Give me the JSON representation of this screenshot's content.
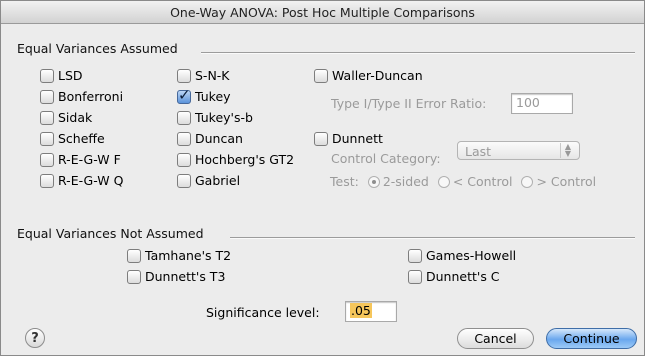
{
  "window": {
    "title": "One-Way ANOVA: Post Hoc Multiple Comparisons"
  },
  "equal": {
    "label": "Equal Variances Assumed",
    "col1": [
      {
        "label": "LSD",
        "checked": false
      },
      {
        "label": "Bonferroni",
        "checked": false
      },
      {
        "label": "Sidak",
        "checked": false
      },
      {
        "label": "Scheffe",
        "checked": false
      },
      {
        "label": "R-E-G-W F",
        "checked": false
      },
      {
        "label": "R-E-G-W Q",
        "checked": false
      }
    ],
    "col2": [
      {
        "label": "S-N-K",
        "checked": false
      },
      {
        "label": "Tukey",
        "checked": true
      },
      {
        "label": "Tukey's-b",
        "checked": false
      },
      {
        "label": "Duncan",
        "checked": false
      },
      {
        "label": "Hochberg's GT2",
        "checked": false
      },
      {
        "label": "Gabriel",
        "checked": false
      }
    ],
    "waller": {
      "label": "Waller-Duncan",
      "checked": false
    },
    "ratio_label": "Type I/Type II Error Ratio:",
    "ratio_value": "100",
    "dunnett": {
      "label": "Dunnett",
      "checked": false
    },
    "control_label": "Control Category:",
    "control_value": "Last",
    "test_label": "Test:",
    "test_options": [
      "2-sided",
      "< Control",
      "> Control"
    ],
    "test_selected": "2-sided"
  },
  "not_equal": {
    "label": "Equal Variances Not Assumed",
    "items": [
      {
        "label": "Tamhane's T2",
        "checked": false
      },
      {
        "label": "Games-Howell",
        "checked": false
      },
      {
        "label": "Dunnett's T3",
        "checked": false
      },
      {
        "label": "Dunnett's C",
        "checked": false
      }
    ]
  },
  "significance": {
    "label": "Significance level:",
    "value": ".05"
  },
  "buttons": {
    "help": "?",
    "cancel": "Cancel",
    "continue": "Continue"
  },
  "colors": {
    "default_button": "#6aa7ee",
    "selection": "#f6c65b"
  }
}
